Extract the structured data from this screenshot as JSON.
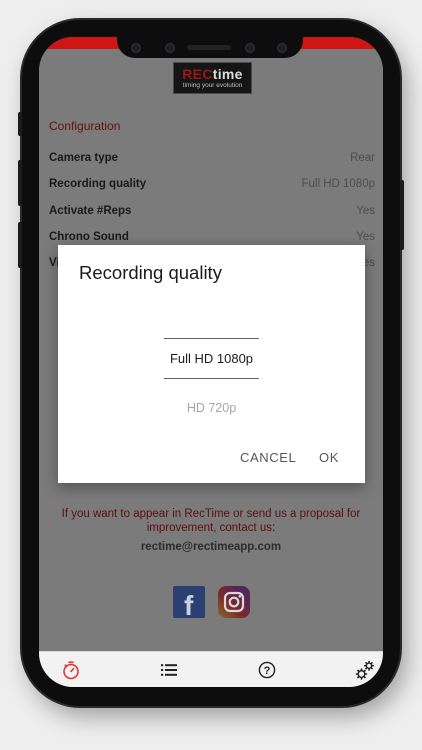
{
  "logo": {
    "brand_rec": "REC",
    "brand_time": "time",
    "tagline": "timing your evolution"
  },
  "config": {
    "section_title": "Configuration",
    "rows": [
      {
        "label": "Camera type",
        "value": "Rear"
      },
      {
        "label": "Recording quality",
        "value": "Full HD 1080p"
      },
      {
        "label": "Activate #Reps",
        "value": "Yes"
      },
      {
        "label": "Chrono Sound",
        "value": "Yes"
      },
      {
        "label": "Vi",
        "value": "es"
      }
    ]
  },
  "contact": {
    "text": "If you want to appear in RecTime or send us a proposal for improvement, contact us:",
    "email": "rectime@rectimeapp.com"
  },
  "social": {
    "facebook_glyph": "f"
  },
  "dialog": {
    "title": "Recording quality",
    "options": [
      "Full HD 1080p",
      "HD 720p"
    ],
    "selected_index": 0,
    "cancel_label": "CANCEL",
    "ok_label": "OK"
  },
  "nav": {
    "help_glyph": "?"
  },
  "colors": {
    "brand_red": "#d01515",
    "accent_dark_red": "#651212",
    "dialog_bg": "#ffffff"
  },
  "icons": [
    "stopwatch-icon",
    "list-icon",
    "help-icon",
    "gears-icon",
    "facebook-icon",
    "instagram-icon"
  ]
}
